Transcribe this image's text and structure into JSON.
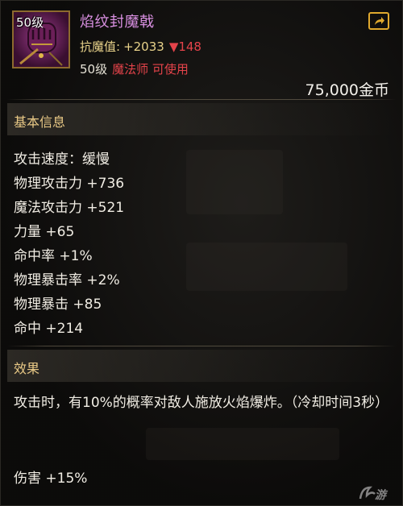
{
  "item": {
    "level_tag": "50级",
    "name": "焰纹封魔戟",
    "resist_label": "抗魔值:",
    "resist_value": "+2033",
    "resist_diff": "▼148",
    "req_level": "50级",
    "req_class": "魔法师 可使用",
    "price": "75,000金币"
  },
  "basic": {
    "title": "基本信息",
    "stats": [
      "攻击速度：缓慢",
      "物理攻击力 +736",
      "魔法攻击力 +521",
      "力量 +65",
      "命中率 +1%",
      "物理暴击率 +2%",
      "物理暴击 +85",
      "命中 +214"
    ]
  },
  "effect": {
    "title": "效果",
    "description": "攻击时，有10%的概率对敌人施放火焰爆炸。（冷却时间3秒）",
    "damage": "伤害 +15%"
  },
  "watermark": "九游",
  "colors": {
    "item_name": "#d88fe0",
    "section_title": "#e9c986",
    "resist": "#e8d28a",
    "warning": "#e4434a",
    "share_icon": "#e0a92e"
  },
  "icons": {
    "item": "purple-gauntlet-icon",
    "share": "share-icon"
  }
}
